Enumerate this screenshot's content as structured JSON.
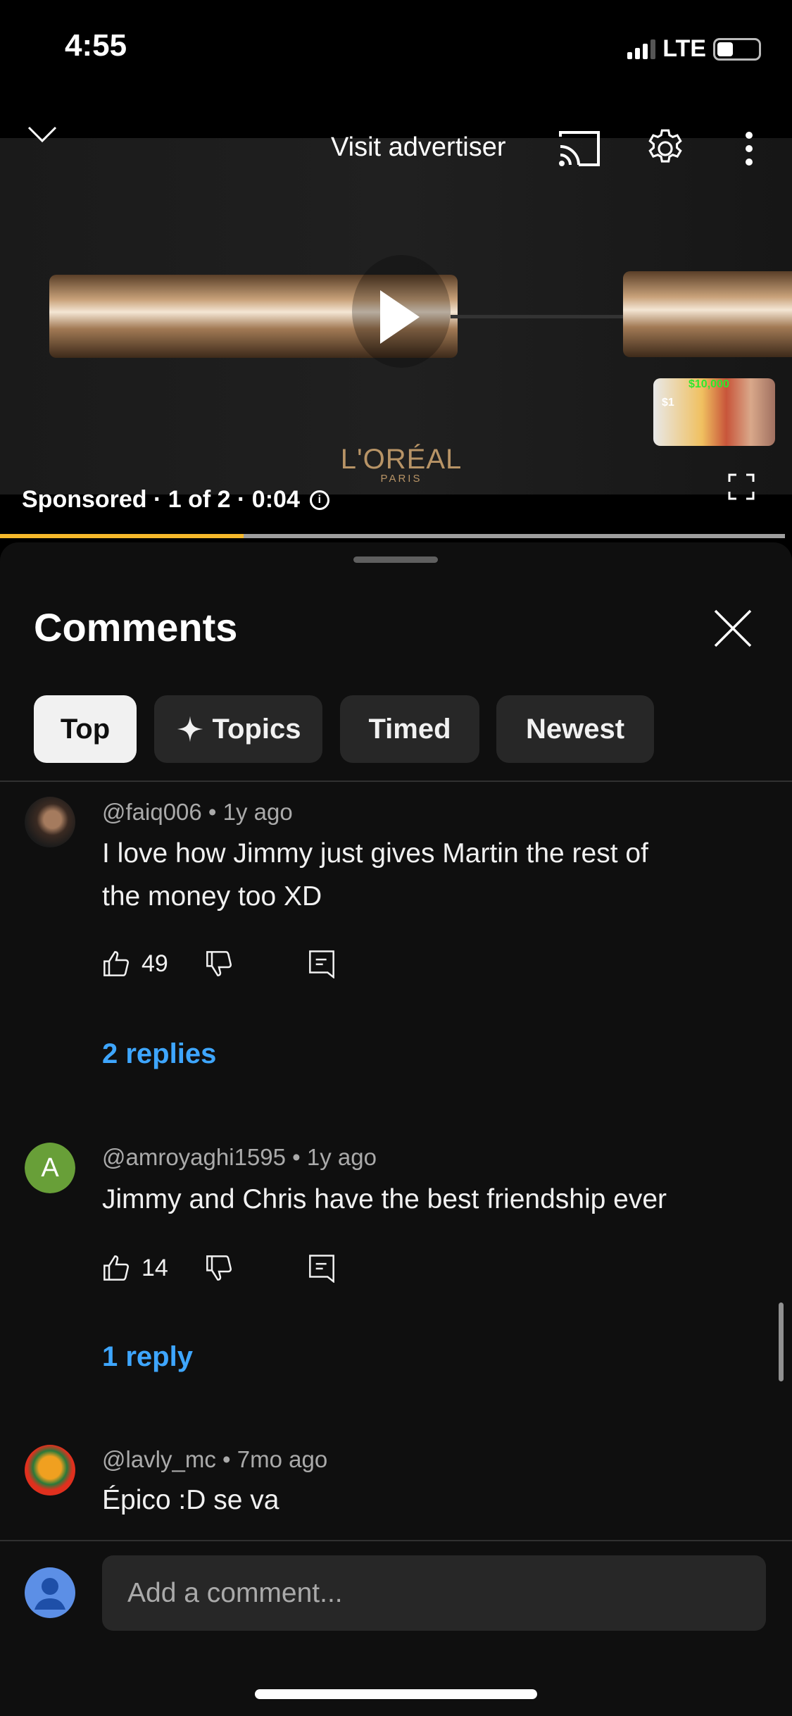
{
  "status_bar": {
    "time": "4:55",
    "network": "LTE",
    "signal_bars": 3,
    "battery_level": 0.35
  },
  "player": {
    "visit_advertiser": "Visit advertiser",
    "brand_logo": "L'ORÉAL",
    "brand_sub": "PARIS",
    "ad_info": "Sponsored · 1 of 2 · 0:04",
    "progress_fraction": 0.31,
    "next_thumb_labels": [
      "$10,000",
      "$1"
    ],
    "icons": [
      "chevron-down-icon",
      "cast-icon",
      "gear-icon",
      "more-vert-icon",
      "play-icon",
      "info-icon",
      "fullscreen-icon"
    ]
  },
  "comments": {
    "title": "Comments",
    "chips": [
      {
        "label": "Top",
        "active": true
      },
      {
        "label": "Topics",
        "icon": "sparkle-icon"
      },
      {
        "label": "Timed"
      },
      {
        "label": "Newest"
      }
    ],
    "items": [
      {
        "meta": "@faiq006 • 1y ago",
        "lines": [
          "I love how Jimmy just gives Martin the rest of",
          "the money too XD"
        ],
        "likes": "49",
        "replies": "2 replies"
      },
      {
        "meta": "@amroyaghi1595 • 1y ago",
        "avatar_letter": "A",
        "avatar_color": "#689f38",
        "lines": [
          "Jimmy and Chris have the best friendship ever"
        ],
        "likes": "14",
        "replies": "1 reply"
      },
      {
        "meta": "@lavly_mc • 7mo ago",
        "lines": [
          "Épico :D se va"
        ]
      }
    ],
    "add_placeholder": "Add a comment..."
  },
  "colors": {
    "accent_link": "#3ea6ff",
    "ad_progress": "#f6b92b",
    "sheet_bg": "#0f0f0f"
  }
}
